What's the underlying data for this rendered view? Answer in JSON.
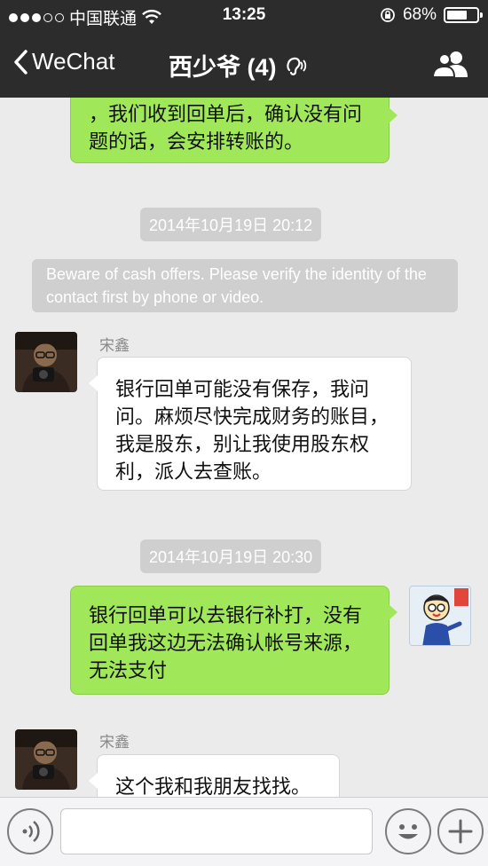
{
  "status_bar": {
    "carrier": "中国联通",
    "time": "13:25",
    "battery": "68%"
  },
  "nav": {
    "back_label": "WeChat",
    "title": "西少爷 (4)"
  },
  "messages": [
    {
      "type": "outgoing",
      "text": "，我们收到回单后，确认没有问题的话，会安排转账的。"
    },
    {
      "type": "timestamp",
      "text": "2014年10月19日 20:12"
    },
    {
      "type": "system",
      "text": "Beware of cash offers. Please verify the identity of the contact first by phone or video."
    },
    {
      "type": "incoming",
      "sender": "宋鑫",
      "text": "银行回单可能没有保存，我问问。麻烦尽快完成财务的账目，我是股东，别让我使用股东权利，派人去查账。"
    },
    {
      "type": "timestamp",
      "text": "2014年10月19日 20:30"
    },
    {
      "type": "outgoing",
      "text": "银行回单可以去银行补打，没有回单我这边无法确认帐号来源，无法支付"
    },
    {
      "type": "incoming",
      "sender": "宋鑫",
      "text": "这个我和我朋友找找。"
    }
  ],
  "input": {
    "value": ""
  },
  "colors": {
    "nav_bg": "#2c2c2c",
    "outgoing_bubble": "#a0e75a",
    "incoming_bubble": "#ffffff",
    "chat_bg": "#ebebeb"
  }
}
